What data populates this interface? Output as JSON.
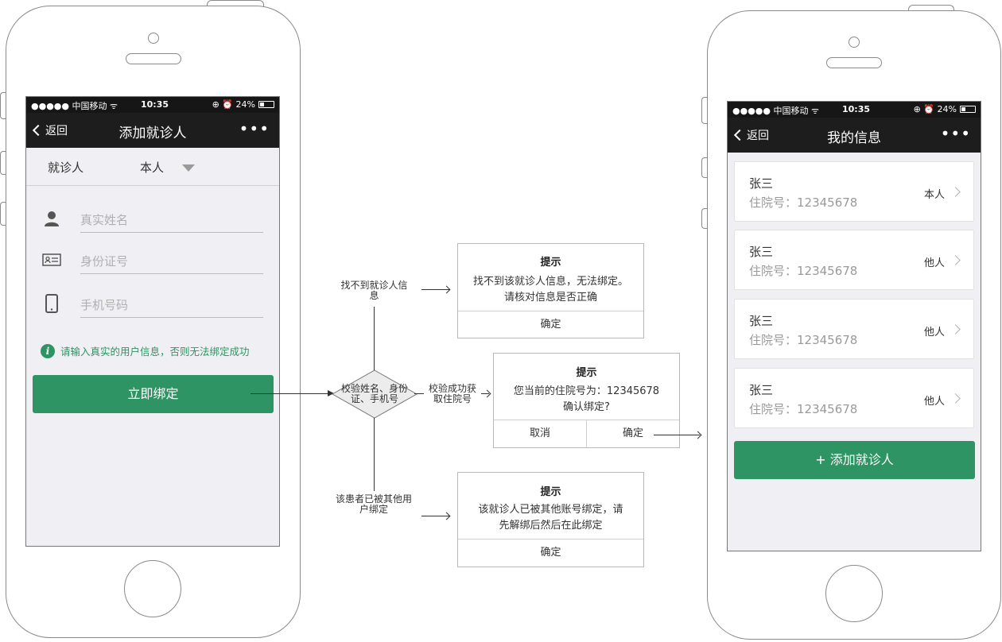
{
  "status_bar": {
    "signal": "●●●●● 中国移动 ᯤ",
    "time": "10:35",
    "battery": "⊕ ⏰ 24%"
  },
  "left_phone": {
    "nav": {
      "back_label": "返回",
      "title": "添加就诊人",
      "more": "•••"
    },
    "picker": {
      "label": "就诊人",
      "value": "本人"
    },
    "fields": [
      {
        "icon": "user-icon",
        "placeholder": "真实姓名"
      },
      {
        "icon": "id-card-icon",
        "placeholder": "身份证号"
      },
      {
        "icon": "phone-icon",
        "placeholder": "手机号码"
      }
    ],
    "hint": "请输入真实的用户信息，否则无法绑定成功",
    "submit_label": "立即绑定"
  },
  "flow": {
    "decision": "校验姓名、身份证、手机号",
    "success_label": "校验成功获取住院号",
    "not_found_label": "找不到就诊人信息",
    "bound_label": "该患者已被其他用户绑定"
  },
  "dialogs": {
    "not_found": {
      "title": "提示",
      "body_1": "找不到该就诊人信息，无法绑定。",
      "body_2": "请核对信息是否正确",
      "ok": "确定"
    },
    "confirm": {
      "title": "提示",
      "body_1": "您当前的住院号为：12345678",
      "body_2": "确认绑定?",
      "cancel": "取消",
      "ok": "确定"
    },
    "bound": {
      "title": "提示",
      "body_1": "该就诊人已被其他账号绑定，请",
      "body_2": "先解绑后然后在此绑定",
      "ok": "确定"
    }
  },
  "right_phone": {
    "nav": {
      "back_label": "返回",
      "title": "我的信息",
      "more": "•••"
    },
    "patients": [
      {
        "name": "张三",
        "record": "住院号：12345678",
        "relation": "本人"
      },
      {
        "name": "张三",
        "record": "住院号：12345678",
        "relation": "他人"
      },
      {
        "name": "张三",
        "record": "住院号：12345678",
        "relation": "他人"
      },
      {
        "name": "张三",
        "record": "住院号：12345678",
        "relation": "他人"
      }
    ],
    "add_label": "+ 添加就诊人"
  },
  "colors": {
    "primary_green": "#2f9463",
    "bar_dark": "#1d1d1d",
    "screen_bg": "#efeff4"
  }
}
